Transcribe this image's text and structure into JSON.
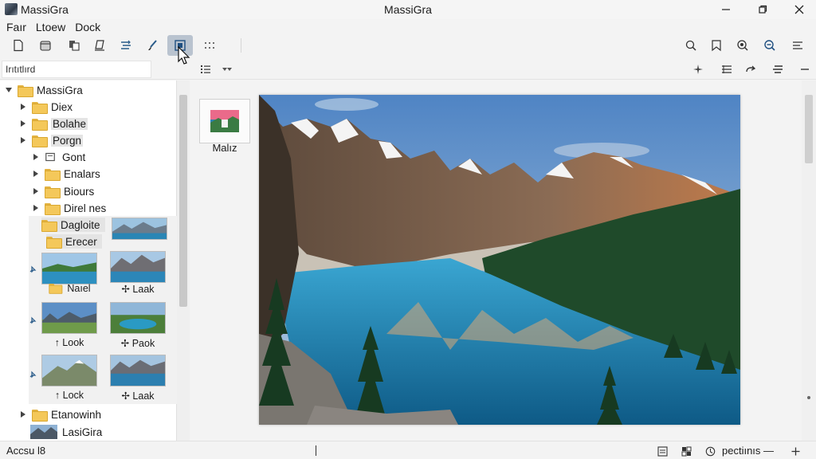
{
  "window": {
    "app_name": "MassiGra",
    "title": "MassiGra",
    "controls": [
      "minimize",
      "maximize",
      "close"
    ]
  },
  "menu": [
    "Faır",
    "Ltoew",
    "Dock"
  ],
  "toolbar": {
    "left_icons": [
      "new-file-icon",
      "open-archive-icon",
      "copy-icon",
      "eraser-icon",
      "transform-icon",
      "brush-icon",
      "frame-icon",
      "grid-icon"
    ],
    "active": "frame-icon",
    "right_icons": [
      "search-icon",
      "bookmark-icon",
      "zoom-in-icon",
      "zoom-out-icon",
      "menu-icon"
    ]
  },
  "subbar": {
    "search_placeholder": "Irıtıtlırd",
    "right_icons": [
      "sparkle-icon",
      "list-icon",
      "redo-icon",
      "align-icon",
      "minus-icon"
    ]
  },
  "tree": {
    "root": "MassiGra",
    "items": [
      {
        "label": "Diex"
      },
      {
        "label": "Bolahe"
      },
      {
        "label": "Porgn"
      },
      {
        "label": "Gont"
      },
      {
        "label": "Enalars"
      },
      {
        "label": "Biours"
      },
      {
        "label": "Direl nes"
      },
      {
        "label": "Dagloite"
      },
      {
        "label": "Erecer"
      }
    ],
    "thumbnails": [
      {
        "caption": "Naıel"
      },
      {
        "caption": "✢ Laak"
      },
      {
        "caption": "↑ Look"
      },
      {
        "caption": "✢ Paok"
      },
      {
        "caption": "↑ Lock"
      },
      {
        "caption": "✢ Laak"
      }
    ],
    "bottom_items": [
      {
        "label": "Etanowinh"
      },
      {
        "label": "LasiGira"
      }
    ]
  },
  "main": {
    "file_name": "Malız"
  },
  "status": {
    "left_text": "Accsu l8",
    "zoom_text": "pectiınıs —",
    "icons": [
      "page-icon",
      "layout-icon",
      "zoom-dial-icon",
      "plus-icon"
    ]
  },
  "colors": {
    "active_tool": "#b9c3cf",
    "folder": "#f4c85a",
    "lake": "#1e7fae",
    "sky": "#8ab4d8"
  }
}
